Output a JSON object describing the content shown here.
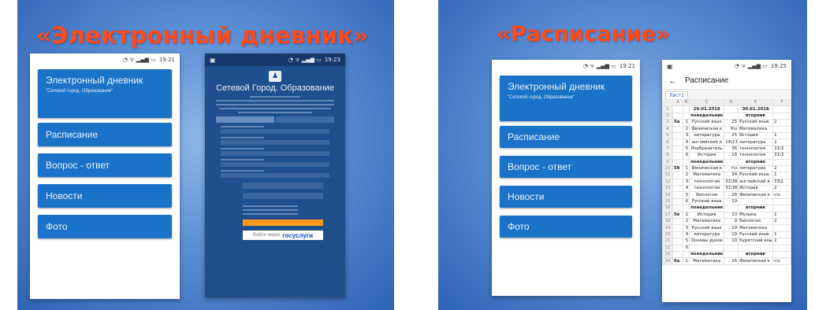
{
  "slide1": {
    "title": "«Электронный дневник»",
    "phone": {
      "status": "19:21",
      "menu": [
        {
          "label": "Электронный дневник",
          "sub": "\"Сетевой город. Образование\""
        },
        {
          "label": "Расписание"
        },
        {
          "label": "Вопрос - ответ"
        },
        {
          "label": "Новости"
        },
        {
          "label": "Фото"
        }
      ]
    },
    "net_phone": {
      "status": "19:23",
      "title": "Сетевой Город. Образование",
      "gosuslugi_prefix": "Войти через",
      "gosuslugi_brand": "госуслуги"
    }
  },
  "slide2": {
    "title": "«Расписание»",
    "phone": {
      "status": "19:21",
      "menu": [
        {
          "label": "Электронный дневник",
          "sub": "\"Сетевой город. Образование\""
        },
        {
          "label": "Расписание"
        },
        {
          "label": "Вопрос - ответ"
        },
        {
          "label": "Новости"
        },
        {
          "label": "Фото"
        }
      ]
    },
    "schedule": {
      "status": "19:25",
      "back_icon": "arrow-left-icon",
      "title": "Расписание",
      "sheet_tab": "Лист1",
      "columns": [
        "A",
        "B",
        "C",
        "D",
        "E",
        "F"
      ],
      "rows": [
        [
          "1",
          "",
          "",
          "29.01.2018",
          "",
          "30.01.2018",
          ""
        ],
        [
          "2",
          "",
          "",
          "понедельник",
          "",
          "вторник",
          ""
        ],
        [
          "3",
          "5а",
          "1",
          "Русский язык",
          "25",
          "Русский язык",
          "2"
        ],
        [
          "4",
          "",
          "2",
          "Физическая к",
          "б\\з",
          "Математика",
          ""
        ],
        [
          "5",
          "",
          "3",
          "литература",
          "25",
          "История",
          "1"
        ],
        [
          "6",
          "",
          "4",
          "английский я",
          "14\\13",
          "литература",
          "2"
        ],
        [
          "7",
          "",
          "5",
          "Изобразитель",
          "36",
          "технология",
          "31\\3"
        ],
        [
          "8",
          "",
          "6",
          "История",
          "18",
          "технология",
          "31\\3"
        ],
        [
          "9",
          "",
          "",
          "понедельник",
          "",
          "вторник",
          ""
        ],
        [
          "10",
          "5б",
          "1",
          "Физическая к",
          "т\\з",
          "литература",
          "2"
        ],
        [
          "11",
          "",
          "2",
          "Математика",
          "34",
          "Русский язык",
          "1"
        ],
        [
          "12",
          "",
          "3",
          "технология",
          "31\\36",
          "английский я",
          "33\\1"
        ],
        [
          "13",
          "",
          "4",
          "технология",
          "31\\36",
          "История",
          "2"
        ],
        [
          "14",
          "",
          "5",
          "Биология",
          "28",
          "Физическая к",
          "с\\з"
        ],
        [
          "15",
          "",
          "6",
          "Русский язык",
          "19",
          "",
          ""
        ],
        [
          "16",
          "",
          "",
          "понедельник",
          "",
          "вторник",
          ""
        ],
        [
          "17",
          "5в",
          "1",
          "История",
          "10",
          "Музыка",
          "1"
        ],
        [
          "18",
          "",
          "2",
          "Математика",
          "9",
          "Биология",
          "2"
        ],
        [
          "19",
          "",
          "3",
          "Русский язык",
          "19",
          "Математика",
          ""
        ],
        [
          "20",
          "",
          "4",
          "литература",
          "19",
          "Русский язык",
          "1"
        ],
        [
          "21",
          "",
          "5",
          "Основы духов",
          "10",
          "бурятский язы",
          "2"
        ],
        [
          "22",
          "",
          "6",
          "",
          "",
          "",
          ""
        ],
        [
          "23",
          "",
          "",
          "понедельник",
          "",
          "вторник",
          ""
        ],
        [
          "24",
          "6а",
          "1",
          "Математика",
          "16",
          "Физическая к",
          "с\\з"
        ]
      ]
    }
  }
}
